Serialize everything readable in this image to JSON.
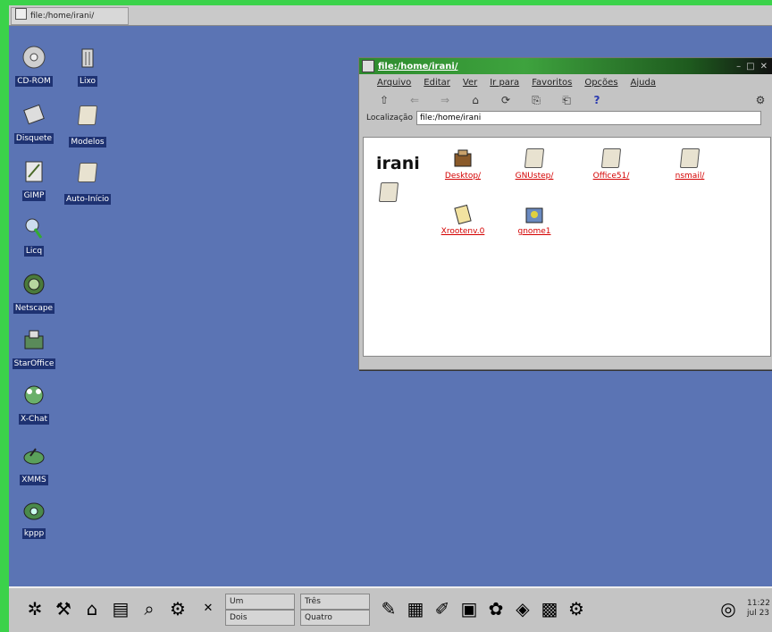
{
  "top_tab": {
    "title": "file:/home/irani/"
  },
  "desktop_icons": [
    {
      "label": "CD-ROM",
      "icon": "cdrom-icon"
    },
    {
      "label": "Lixo",
      "icon": "trash-icon"
    },
    {
      "label": "Disquete",
      "icon": "floppy-icon"
    },
    {
      "label": "Modelos",
      "icon": "folder-icon"
    },
    {
      "label": "GIMP",
      "icon": "gimp-icon"
    },
    {
      "label": "Auto-Início",
      "icon": "folder-icon"
    },
    {
      "label": "Licq",
      "icon": "licq-icon"
    },
    {
      "label": "Netscape",
      "icon": "netscape-icon"
    },
    {
      "label": "StarOffice",
      "icon": "staroffice-icon"
    },
    {
      "label": "X-Chat",
      "icon": "xchat-icon"
    },
    {
      "label": "XMMS",
      "icon": "xmms-icon"
    },
    {
      "label": "kppp",
      "icon": "phone-icon"
    }
  ],
  "window": {
    "title": "file:/home/irani/",
    "menu": [
      "Arquivo",
      "Editar",
      "Ver",
      "Ir para",
      "Favoritos",
      "Opções",
      "Ajuda"
    ],
    "toolbar": [
      "⇧",
      "⇐",
      "⇒",
      "⌂",
      "⟳",
      "⎘",
      "⎗",
      "?"
    ],
    "location_label": "Localização",
    "location_value": "file:/home/irani",
    "dir_name": "irani",
    "files": [
      "Desktop/",
      "GNUstep/",
      "Office51/",
      "nsmail/",
      "Xrootenv.0",
      "gnome1"
    ]
  },
  "panel": {
    "pager": [
      "Um",
      "Três",
      "Dois",
      "Quatro"
    ],
    "clock_time": "11:22",
    "clock_date": "jul 23"
  }
}
